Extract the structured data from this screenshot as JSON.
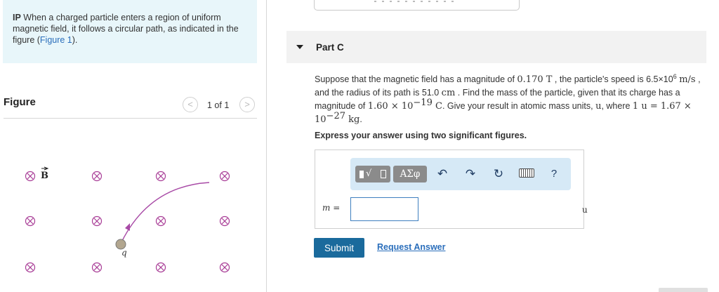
{
  "intro": {
    "prefix": "IP",
    "text": " When a charged particle enters a region of uniform magnetic field, it follows a circular path, as indicated in the figure (",
    "link_text": "Figure 1",
    "suffix": ")."
  },
  "figure_panel": {
    "heading": "Figure",
    "pager_prev": "<",
    "pager_text": "1 of 1",
    "pager_next": ">",
    "field_label": "B",
    "particle_label": "q",
    "x_symbol": "⊗"
  },
  "part": {
    "title": "Part C",
    "problem": {
      "s1": "Suppose that the magnetic field has a magnitude of ",
      "field_value": "0.170 T",
      "s2": " , the particle's speed is 6.5×10",
      "speed_exp": "6",
      "speed_unit": "m/s",
      "s3": " , and the radius of its path is 51.0 ",
      "radius_unit": "cm",
      "s4": " . Find the mass of the particle, given that its charge has a magnitude of ",
      "charge": "1.60 × 10",
      "charge_exp": "−19",
      "charge_unit": " C",
      "s5": ". Give your result in atomic mass units, ",
      "amu_symbol": "u",
      "s6": ", where ",
      "amu_def": "1 u = 1.67 × 10",
      "amu_exp": "−27",
      "amu_unit": " kg",
      "s7": "."
    },
    "instruction": "Express your answer using two significant figures."
  },
  "answer": {
    "toolbar": {
      "greek": "ΑΣφ",
      "undo_icon": "undo-icon",
      "redo_icon": "redo-icon",
      "reset_icon": "reset-icon",
      "keyboard_icon": "keyboard-icon",
      "help": "?"
    },
    "variable_label": "m =",
    "input_value": "",
    "unit": "u"
  },
  "actions": {
    "submit": "Submit",
    "request_answer": "Request Answer"
  },
  "colors": {
    "intro_bg": "#e8f6fa",
    "link": "#2a6ebb",
    "submit_bg": "#1a6a9c",
    "toolbar_bg": "#d6e9f6",
    "arc": "#a84aa6",
    "x_symbol": "#a83c96",
    "particle": "#b2a68f"
  }
}
